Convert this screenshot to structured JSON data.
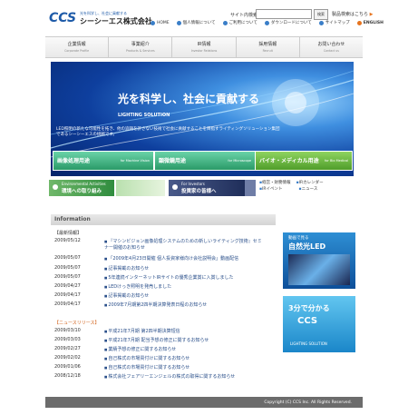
{
  "header": {
    "logo_mark": "CCS",
    "logo_tagline": "光を科学し、社会に貢献する",
    "company_name": "シーシーエス株式会社",
    "search_label": "サイト内検索",
    "search_button": "検索",
    "product_search": "製品検索はこちら",
    "util_links": [
      {
        "label": "HOME",
        "icon": "home-dot"
      },
      {
        "label": "個人情報について",
        "icon": "dot"
      },
      {
        "label": "ご利用について",
        "icon": "dot"
      },
      {
        "label": "ダウンロードについて",
        "icon": "dot"
      },
      {
        "label": "サイトマップ",
        "icon": "dot"
      },
      {
        "label": "ENGLISH",
        "icon": "en-dot"
      }
    ]
  },
  "nav": [
    {
      "label": "企業情報",
      "sub": "Corporate Profile"
    },
    {
      "label": "事業紹介",
      "sub": "Products & Services"
    },
    {
      "label": "IR情報",
      "sub": "Investor Relations"
    },
    {
      "label": "採用情報",
      "sub": "Recruit"
    },
    {
      "label": "お問い合わせ",
      "sub": "Contact us"
    }
  ],
  "hero": {
    "title": "光を科学し、社会に貢献する",
    "subtitle": "LIGHTING SOLUTION",
    "text": "LED照明の新たな可能性を拓き、他の追随を許さない技術で社会に貢献することを目指すライティングソリューション集団であるシーシーエスの挑戦です。"
  },
  "categories": [
    {
      "label": "画像処理用途",
      "sub": "for Machine Vision"
    },
    {
      "label": "顕微鏡用途",
      "sub": "for Microscope"
    },
    {
      "label": "バイオ・メディカル用途",
      "sub": "for Bio Medical"
    }
  ],
  "banners": {
    "env_en": "Environmental Activities",
    "env_jp": "環境への取り組み",
    "inv_en": "For Investors",
    "inv_jp": "投資家の皆様へ"
  },
  "ir_links": [
    [
      "経営・財務情報",
      "IRカレンダー"
    ],
    [
      "IRイベント",
      "ニュース"
    ]
  ],
  "information": {
    "title": "Information",
    "latest_label": "【最新情報】",
    "latest": [
      {
        "date": "2009/05/12",
        "title": "『マシンビジョン画像処理システムのための新しいライティング技術』セミ",
        "title2": "ナー開催のお知らせ"
      },
      {
        "date": "2009/05/07",
        "title": "「2009年4月23日開催 個人投資家様向け会社説明会」動画配信"
      },
      {
        "date": "2009/05/07",
        "title": "記事掲載のお知らせ"
      },
      {
        "date": "2009/05/07",
        "title": "5年連続インターネットIRサイトの優秀企業賞に入賞しました"
      },
      {
        "date": "2009/04/27",
        "title": "LEDけっき照明を発売しました"
      },
      {
        "date": "2009/04/17",
        "title": "記事掲載のお知らせ"
      },
      {
        "date": "2009/04/17",
        "title": "2009年7月期第2四半期決算発表日程のお知らせ"
      }
    ],
    "news_label": "【ニュースリリース】",
    "news": [
      {
        "date": "2009/03/10",
        "title": "平成21年7月期 第2四半期決算短信"
      },
      {
        "date": "2009/03/03",
        "title": "平成21年7月期 配当予想の修正に関するお知らせ"
      },
      {
        "date": "2009/02/27",
        "title": "業績予想の修正に関するお知らせ"
      },
      {
        "date": "2009/02/02",
        "title": "自己株式の市場買付けに関するお知らせ"
      },
      {
        "date": "2009/01/06",
        "title": "自己株式の市場買付けに関するお知らせ"
      },
      {
        "date": "2008/12/18",
        "title": "株式会社フェアリーエンジェルの株式の取得に関するお知らせ"
      }
    ]
  },
  "side": {
    "video_a": "動画で見る",
    "video_b": "自然光LED",
    "minutes_a": "3分で分かる",
    "minutes_b": "CCS",
    "minutes_c": "LIGHTING SOLUTION"
  },
  "footer": {
    "copyright": "Copyright (C) CCS Inc. All Rights Reserved."
  }
}
